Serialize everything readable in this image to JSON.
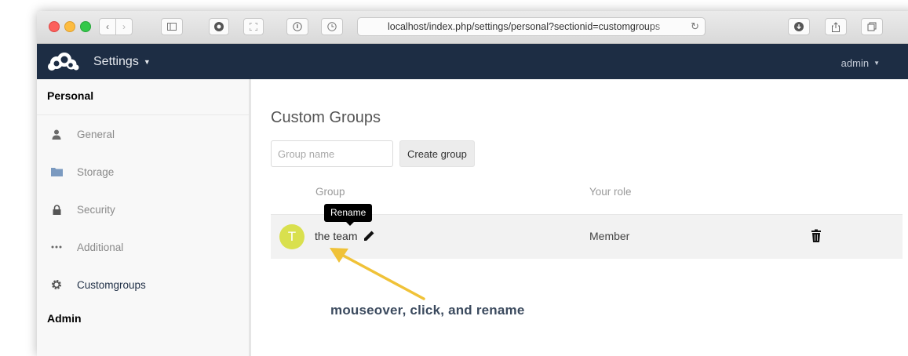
{
  "browser": {
    "url": "localhost/index.php/settings/personal?sectionid=customgroups",
    "icons": [
      "back-icon",
      "forward-icon",
      "sidebar-icon",
      "grammarly-icon",
      "fullscreen-icon",
      "info-icon",
      "history-icon",
      "reload-icon",
      "download-icon",
      "share-icon",
      "tabs-icon"
    ]
  },
  "header": {
    "app_menu_label": "Settings",
    "user_label": "admin",
    "color": "#1d2d44"
  },
  "sidebar": {
    "personal_heading": "Personal",
    "items": [
      {
        "label": "General",
        "icon": "user-icon"
      },
      {
        "label": "Storage",
        "icon": "folder-icon"
      },
      {
        "label": "Security",
        "icon": "lock-icon"
      },
      {
        "label": "Additional",
        "icon": "more-icon"
      },
      {
        "label": "Customgroups",
        "icon": "gear-icon"
      }
    ],
    "admin_heading": "Admin"
  },
  "main": {
    "title": "Custom Groups",
    "group_name_placeholder": "Group name",
    "create_button": "Create group",
    "columns": {
      "group": "Group",
      "role": "Your role"
    },
    "rows": [
      {
        "avatar_letter": "T",
        "name": "the team",
        "role": "Member",
        "avatar_color": "#d9e04e"
      }
    ],
    "tooltip": "Rename",
    "annotation": "mouseover, click, and rename",
    "annotation_arrow_color": "#f0c238"
  }
}
